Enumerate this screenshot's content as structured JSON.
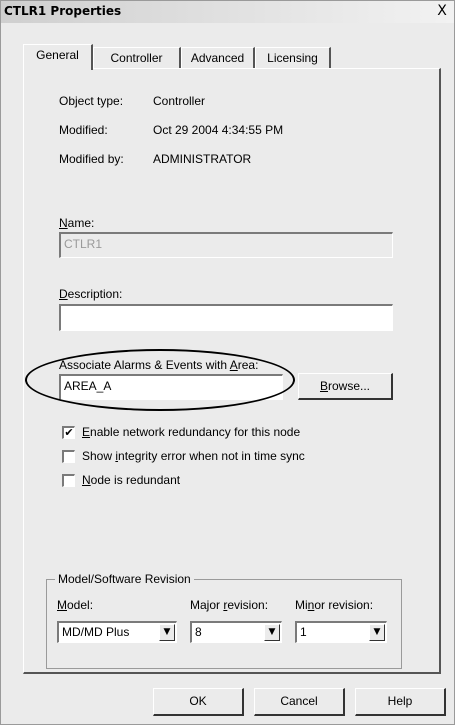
{
  "window": {
    "title": "CTLR1 Properties",
    "close_glyph": "X"
  },
  "tabs": [
    "General",
    "Controller",
    "Advanced",
    "Licensing"
  ],
  "info": {
    "object_type_label": "Object type:",
    "object_type_value": "Controller",
    "modified_label": "Modified:",
    "modified_value": "Oct 29 2004 4:34:55 PM",
    "modified_by_label": "Modified by:",
    "modified_by_value": "ADMINISTRATOR"
  },
  "name": {
    "label_mnemonic": "N",
    "label_rest": "ame:",
    "value": "CTLR1"
  },
  "description": {
    "label_mnemonic": "D",
    "label_rest": "escription:",
    "value": ""
  },
  "area": {
    "label_pre": "Associate Alarms & Events with ",
    "label_mnemonic": "A",
    "label_post": "rea:",
    "value": "AREA_A",
    "browse_mnemonic": "B",
    "browse_rest": "rowse..."
  },
  "checkboxes": [
    {
      "mn": "E",
      "rest": "nable network redundancy for this node",
      "checked": true
    },
    {
      "pre": "Show ",
      "mn": "i",
      "rest": "ntegrity error when not in time sync",
      "checked": false
    },
    {
      "mn": "N",
      "rest": "ode is redundant",
      "checked": false
    }
  ],
  "check_glyph": "✔",
  "model_group": {
    "title": "Model/Software Revision",
    "model_mn": "M",
    "model_rest": "odel:",
    "model_value": "MD/MD Plus",
    "major_pre": "Major ",
    "major_mn": "r",
    "major_rest": "evision:",
    "major_value": "8",
    "minor_pre": "Mi",
    "minor_mn": "n",
    "minor_rest": "or revision:",
    "minor_value": "1",
    "arrow_glyph": "▼"
  },
  "buttons": {
    "ok": "OK",
    "cancel": "Cancel",
    "help": "Help"
  }
}
